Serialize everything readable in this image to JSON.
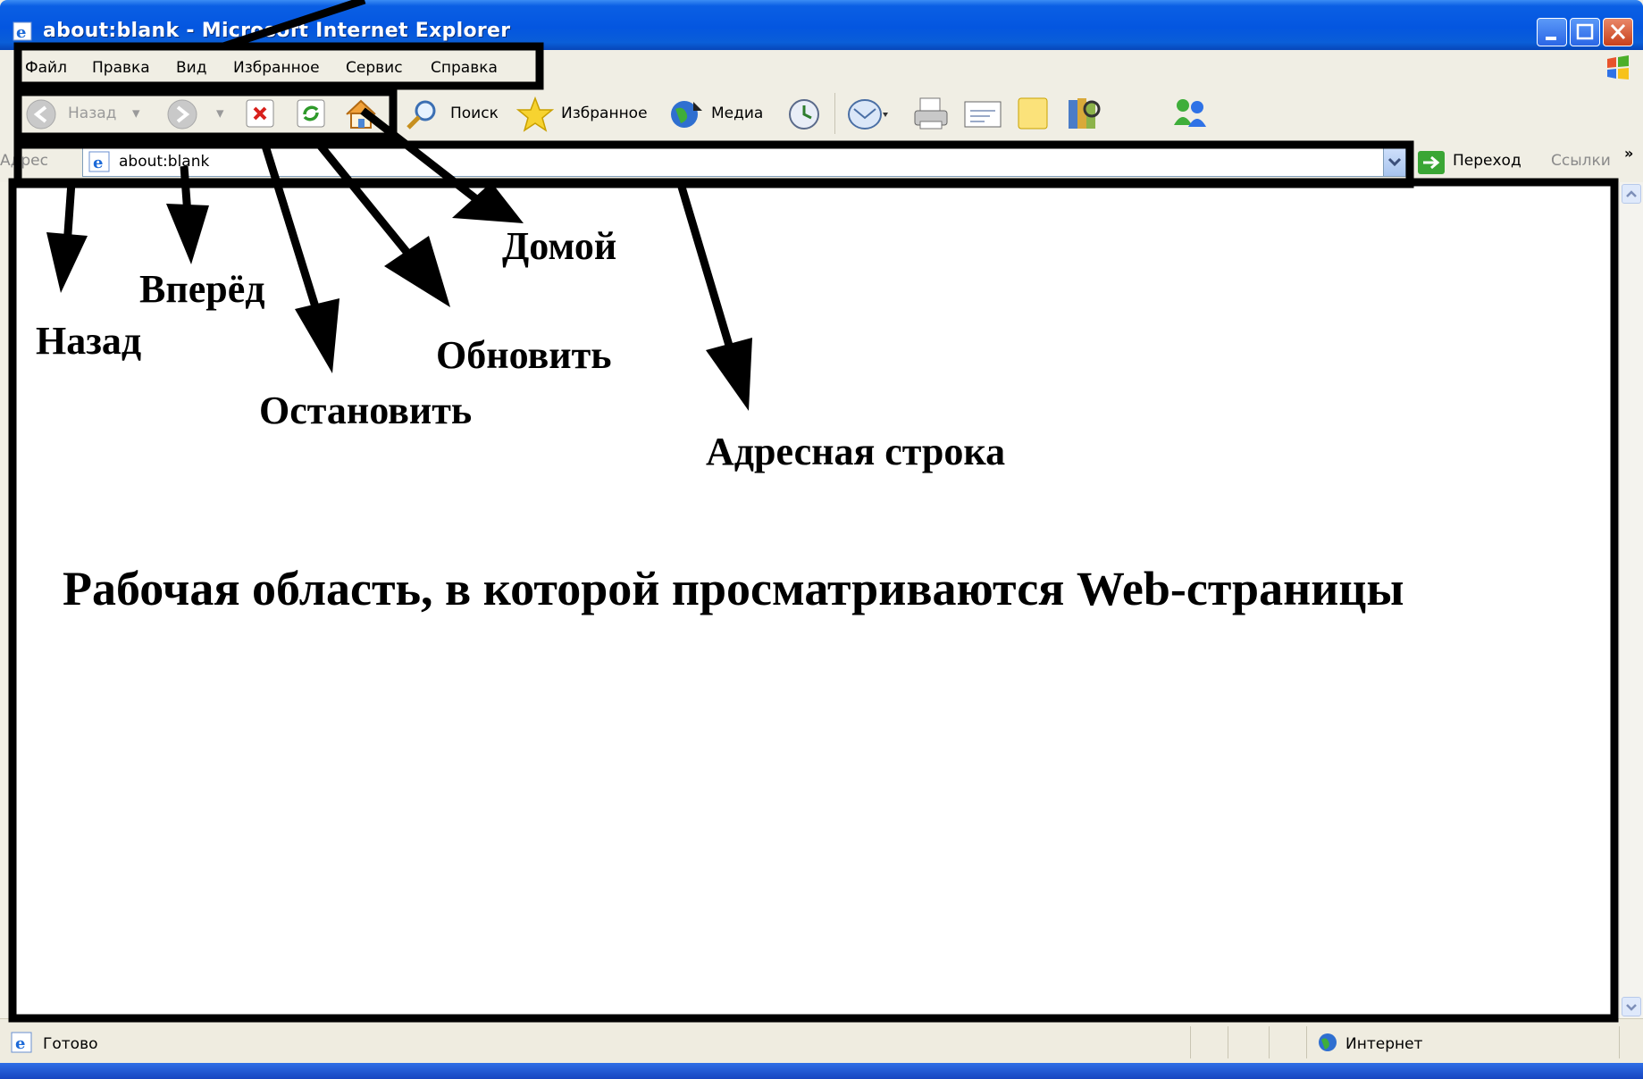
{
  "window": {
    "title": "about:blank - Microsoft Internet Explorer"
  },
  "menu": {
    "items": [
      "Файл",
      "Правка",
      "Вид",
      "Избранное",
      "Сервис",
      "Справка"
    ]
  },
  "toolbar": {
    "back_label": "Назад",
    "search_label": "Поиск",
    "favorites_label": "Избранное",
    "media_label": "Медиа"
  },
  "address": {
    "label": "Адрес",
    "value": "about:blank",
    "go_label": "Переход",
    "links_label": "Ссылки"
  },
  "status": {
    "text": "Готово",
    "zone": "Интернет"
  },
  "annotations": {
    "back": "Назад",
    "forward": "Вперёд",
    "stop": "Остановить",
    "refresh": "Обновить",
    "home": "Домой",
    "address_bar": "Адресная строка",
    "workspace": "Рабочая область, в которой просматриваются Web-страницы"
  },
  "colors": {
    "titlebar": "#0456e0",
    "chrome": "#f0eee4",
    "annotation": "#000000"
  }
}
